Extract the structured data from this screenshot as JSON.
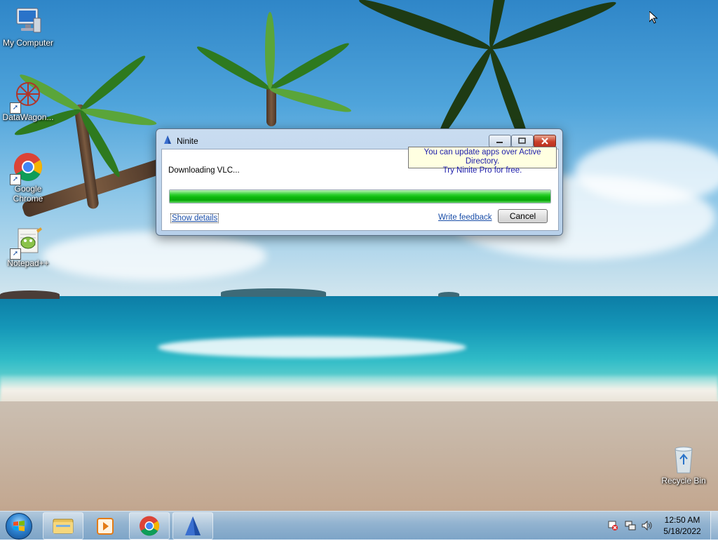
{
  "desktop": {
    "icons": [
      {
        "label": "My Computer",
        "icon": "computer-icon"
      },
      {
        "label": "DataWagon...",
        "icon": "datawagon-icon"
      },
      {
        "label": "Google Chrome",
        "icon": "chrome-icon"
      },
      {
        "label": "Notepad++",
        "icon": "notepadpp-icon"
      },
      {
        "label": "Recycle Bin",
        "icon": "recycle-bin-icon"
      }
    ]
  },
  "window": {
    "title": "Ninite",
    "status_text": "Downloading VLC...",
    "progress": 1.0,
    "show_details_label": "Show details",
    "write_feedback_label": "Write feedback",
    "cancel_label": "Cancel",
    "tooltip_line1": "You can update apps over Active Directory.",
    "tooltip_line2": "Try Ninite Pro for free."
  },
  "taskbar": {
    "pinned": [
      "explorer-icon",
      "media-player-icon",
      "chrome-icon",
      "ninite-icon"
    ],
    "tray_icons": [
      "action-center-icon",
      "network-icon",
      "volume-icon"
    ],
    "time": "12:50 AM",
    "date": "5/18/2022"
  },
  "colors": {
    "link": "#1a4ea8",
    "tooltip_bg": "#ffffe1",
    "progress_green": "#0db90d"
  }
}
